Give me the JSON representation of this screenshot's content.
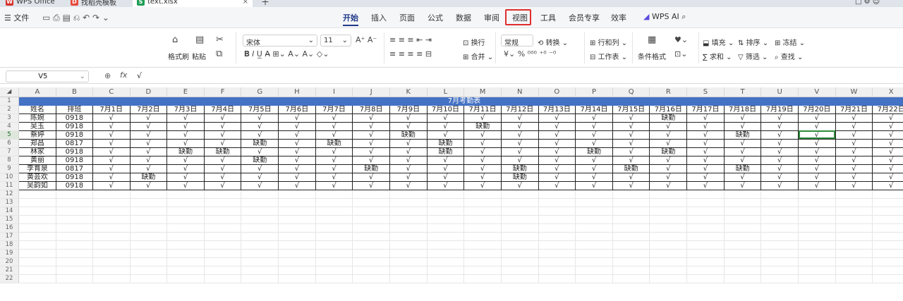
{
  "titlebar": {
    "tabs": [
      {
        "label": "WPS Office",
        "icon": "wps-logo-icon"
      },
      {
        "label": "找稻壳模板",
        "icon": "docer-icon"
      },
      {
        "label": "text.xlsx",
        "icon": "spreadsheet-icon",
        "active": true
      }
    ]
  },
  "menubar": {
    "file_label": "文件",
    "tabs": [
      "开始",
      "插入",
      "页面",
      "公式",
      "数据",
      "审阅",
      "视图",
      "工具",
      "会员专享",
      "效率"
    ],
    "active_tab": "开始",
    "highlighted_tab": "视图",
    "ai_label": "WPS AI"
  },
  "ribbon": {
    "format_painter": "格式刷",
    "paste": "粘贴",
    "font_name": "宋体",
    "font_size": "11",
    "wrap": "换行",
    "merge": "合并",
    "number_format": "常规",
    "convert": "转换",
    "rows_cols": "行和列",
    "worksheet": "工作表",
    "cond_format": "条件格式",
    "fill": "填充",
    "sort": "排序",
    "freeze": "冻结",
    "sum": "求和",
    "filter": "筛选",
    "find": "查找"
  },
  "formula_bar": {
    "cell_ref": "V5",
    "fx": "fx",
    "content": "√"
  },
  "sheet": {
    "columns": [
      "A",
      "B",
      "C",
      "D",
      "E",
      "F",
      "G",
      "H",
      "I",
      "J",
      "K",
      "L",
      "M",
      "N",
      "O",
      "P",
      "Q",
      "R",
      "S",
      "T",
      "U",
      "V",
      "W",
      "X"
    ],
    "selected_column": "V",
    "selected_row": 5,
    "banner": "7月考勤表",
    "headers": [
      "姓名",
      "排班",
      "7月1日",
      "7月2日",
      "7月3日",
      "7月4日",
      "7月5日",
      "7月6日",
      "7月7日",
      "7月8日",
      "7月9日",
      "7月10日",
      "7月11日",
      "7月12日",
      "7月13日",
      "7月14日",
      "7月15日",
      "7月16日",
      "7月17日",
      "7月18日",
      "7月19日",
      "7月20日",
      "7月21日",
      "7月22日"
    ],
    "rows": [
      [
        "陈婉",
        "0918",
        "√",
        "√",
        "√",
        "√",
        "√",
        "√",
        "√",
        "√",
        "√",
        "√",
        "√",
        "√",
        "√",
        "√",
        "√",
        "缺勤",
        "√",
        "√",
        "√",
        "√",
        "√",
        "√"
      ],
      [
        "吴玉",
        "0918",
        "√",
        "√",
        "√",
        "√",
        "√",
        "√",
        "√",
        "√",
        "√",
        "√",
        "缺勤",
        "√",
        "√",
        "√",
        "√",
        "√",
        "√",
        "√",
        "√",
        "√",
        "√",
        "√"
      ],
      [
        "蔡婷",
        "0918",
        "√",
        "√",
        "√",
        "√",
        "√",
        "√",
        "√",
        "√",
        "缺勤",
        "√",
        "√",
        "√",
        "√",
        "√",
        "√",
        "√",
        "√",
        "缺勤",
        "√",
        "√",
        "√",
        "√"
      ],
      [
        "郑昌",
        "0817",
        "√",
        "√",
        "√",
        "√",
        "缺勤",
        "√",
        "缺勤",
        "√",
        "√",
        "缺勤",
        "√",
        "√",
        "√",
        "√",
        "√",
        "√",
        "√",
        "√",
        "√",
        "√",
        "√",
        "√"
      ],
      [
        "林家",
        "0918",
        "√",
        "√",
        "缺勤",
        "缺勤",
        "√",
        "√",
        "√",
        "√",
        "√",
        "缺勤",
        "√",
        "√",
        "√",
        "缺勤",
        "√",
        "缺勤",
        "√",
        "√",
        "√",
        "√",
        "√",
        "√"
      ],
      [
        "黄丽",
        "0918",
        "√",
        "√",
        "√",
        "√",
        "缺勤",
        "√",
        "√",
        "√",
        "√",
        "√",
        "√",
        "√",
        "√",
        "√",
        "√",
        "√",
        "√",
        "√",
        "√",
        "√",
        "√",
        "√"
      ],
      [
        "李育泉",
        "0817",
        "√",
        "√",
        "√",
        "√",
        "√",
        "√",
        "√",
        "缺勤",
        "√",
        "√",
        "√",
        "缺勤",
        "√",
        "√",
        "缺勤",
        "√",
        "√",
        "缺勤",
        "√",
        "√",
        "√",
        "√"
      ],
      [
        "黄芸欢",
        "0918",
        "√",
        "缺勤",
        "√",
        "√",
        "√",
        "√",
        "√",
        "√",
        "√",
        "√",
        "√",
        "缺勤",
        "√",
        "√",
        "√",
        "√",
        "√",
        "√",
        "√",
        "√",
        "√",
        "√"
      ],
      [
        "吴韵如",
        "0918",
        "√",
        "√",
        "√",
        "√",
        "√",
        "√",
        "√",
        "√",
        "√",
        "√",
        "√",
        "√",
        "√",
        "√",
        "√",
        "√",
        "√",
        "√",
        "√",
        "√",
        "√",
        "√"
      ]
    ],
    "empty_row_numbers": [
      12,
      13,
      14,
      15,
      16,
      17,
      18,
      19,
      20,
      21,
      22
    ]
  }
}
